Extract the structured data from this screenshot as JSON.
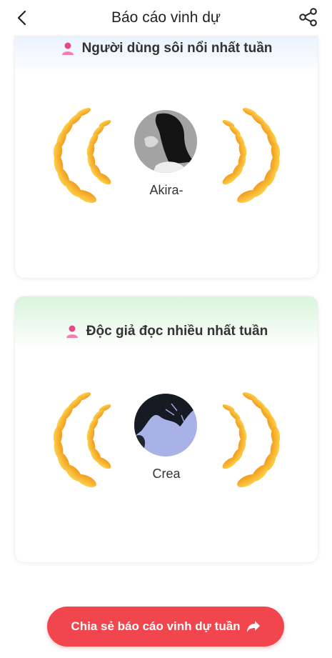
{
  "header": {
    "title": "Báo cáo vinh dự",
    "back_icon": "chevron-left-icon",
    "share_icon": "share-icon"
  },
  "cards": [
    {
      "title": "Người dùng sôi nổi nhất tuần",
      "icon": "user-icon",
      "header_color": "#eaf3fd",
      "user": {
        "name": "Akira-"
      }
    },
    {
      "title": "Độc giả đọc nhiều nhất tuần",
      "icon": "user-icon",
      "header_color": "#d9f5da",
      "user": {
        "name": "Crea"
      }
    }
  ],
  "share_button": {
    "label": "Chia sẻ báo cáo vinh dự tuần",
    "icon": "share-arrow-icon",
    "color": "#f2464f"
  },
  "colors": {
    "accent": "#f2464f",
    "icon_pink": "#e8488a",
    "laurel_gold": "#f7b21c"
  }
}
